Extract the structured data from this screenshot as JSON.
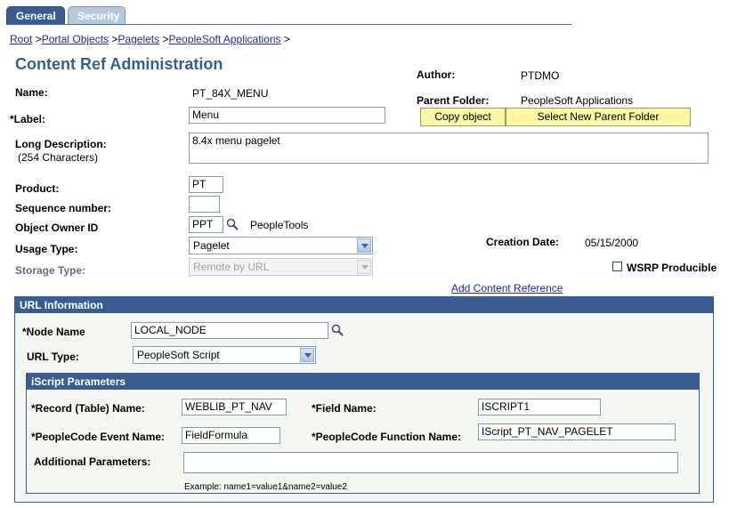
{
  "tabs": [
    {
      "label": "General",
      "active": true
    },
    {
      "label": "Security",
      "active": false
    }
  ],
  "breadcrumb": [
    {
      "label": "Root",
      "sep": " >"
    },
    {
      "label": "Portal Objects",
      "sep": " >"
    },
    {
      "label": "Pagelets",
      "sep": " >"
    },
    {
      "label": "PeopleSoft Applications",
      "sep": " >"
    }
  ],
  "page_title": "Content Ref Administration",
  "author": {
    "label": "Author:",
    "value": "PTDMO"
  },
  "parent_folder": {
    "label": "Parent Folder:",
    "value": "PeopleSoft Applications"
  },
  "buttons": {
    "copy_object": "Copy object",
    "select_parent": "Select New Parent Folder"
  },
  "name": {
    "label": "Name:",
    "value": "PT_84X_MENU"
  },
  "label_field": {
    "label": "*Label:",
    "value": "Menu"
  },
  "long_description": {
    "label": "Long Description:",
    "sublabel": "(254 Characters)",
    "value": "8.4x menu pagelet"
  },
  "product": {
    "label": "Product:",
    "value": "PT"
  },
  "sequence_number": {
    "label": "Sequence number:",
    "value": ""
  },
  "object_owner": {
    "label": "Object Owner ID",
    "value": "PPT",
    "description": "PeopleTools"
  },
  "usage_type": {
    "label": "Usage Type:",
    "value": "Pagelet"
  },
  "storage_type": {
    "label": "Storage Type:",
    "value": "Remote by URL"
  },
  "creation_date": {
    "label": "Creation Date:",
    "value": "05/15/2000"
  },
  "wsrp": {
    "label": "WSRP Producible",
    "checked": false
  },
  "add_content_reference": "Add Content Reference",
  "url_information": {
    "header": "URL Information",
    "node_name": {
      "label": "*Node Name",
      "value": "LOCAL_NODE"
    },
    "url_type": {
      "label": "URL Type:",
      "value": "PeopleSoft Script"
    }
  },
  "iscript": {
    "header": "iScript Parameters",
    "record": {
      "label": "*Record (Table) Name:",
      "value": "WEBLIB_PT_NAV"
    },
    "field": {
      "label": "*Field Name:",
      "value": "ISCRIPT1"
    },
    "event": {
      "label": "*PeopleCode Event Name:",
      "value": "FieldFormula"
    },
    "function": {
      "label": "*PeopleCode Function Name:",
      "value": "IScript_PT_NAV_PAGELET"
    },
    "additional": {
      "label": "Additional Parameters:",
      "value": ""
    },
    "example": "Example: name1=value1&name2=value2"
  },
  "colors": {
    "accent": "#3a5d91",
    "button": "#fbf7a4",
    "group_bg": "#f4f6f1",
    "link": "#1a2d9c"
  }
}
